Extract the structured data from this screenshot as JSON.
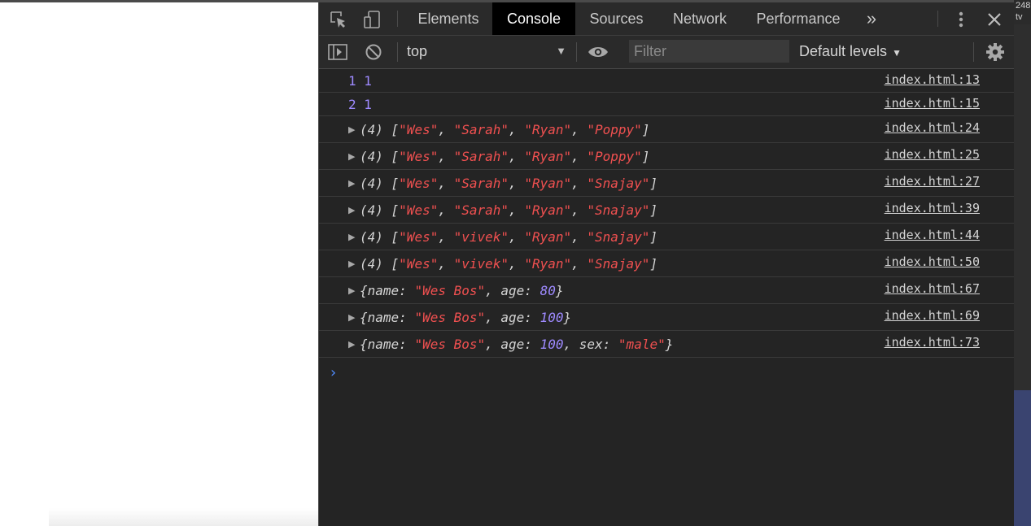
{
  "right_strip": {
    "text_top": "248",
    "text_second": "tv"
  },
  "devtools": {
    "tabs": [
      {
        "label": "Elements",
        "active": false
      },
      {
        "label": "Console",
        "active": true
      },
      {
        "label": "Sources",
        "active": false
      },
      {
        "label": "Network",
        "active": false
      },
      {
        "label": "Performance",
        "active": false
      }
    ],
    "more_tabs_glyph": "»",
    "toolbar": {
      "context": "top",
      "filter_placeholder": "Filter",
      "levels": "Default levels"
    },
    "colors": {
      "number": "#9e8aff",
      "string": "#f05050",
      "prompt": "#4f8cff",
      "active_tab_bg": "#000000"
    }
  },
  "console": {
    "rows": [
      {
        "tokens": [
          {
            "t": "1 1",
            "c": "num"
          }
        ],
        "source": "index.html:13",
        "expandable": false
      },
      {
        "tokens": [
          {
            "t": "2 1",
            "c": "num"
          }
        ],
        "source": "index.html:15",
        "expandable": false
      },
      {
        "tokens": [
          {
            "t": "(4) [",
            "c": "plain"
          },
          {
            "t": "\"Wes\"",
            "c": "str"
          },
          {
            "t": ", ",
            "c": "plain"
          },
          {
            "t": "\"Sarah\"",
            "c": "str"
          },
          {
            "t": ", ",
            "c": "plain"
          },
          {
            "t": "\"Ryan\"",
            "c": "str"
          },
          {
            "t": ", ",
            "c": "plain"
          },
          {
            "t": "\"Poppy\"",
            "c": "str"
          },
          {
            "t": "]",
            "c": "plain"
          }
        ],
        "source": "index.html:24",
        "expandable": true
      },
      {
        "tokens": [
          {
            "t": "(4) [",
            "c": "plain"
          },
          {
            "t": "\"Wes\"",
            "c": "str"
          },
          {
            "t": ", ",
            "c": "plain"
          },
          {
            "t": "\"Sarah\"",
            "c": "str"
          },
          {
            "t": ", ",
            "c": "plain"
          },
          {
            "t": "\"Ryan\"",
            "c": "str"
          },
          {
            "t": ", ",
            "c": "plain"
          },
          {
            "t": "\"Poppy\"",
            "c": "str"
          },
          {
            "t": "]",
            "c": "plain"
          }
        ],
        "source": "index.html:25",
        "expandable": true
      },
      {
        "tokens": [
          {
            "t": "(4) [",
            "c": "plain"
          },
          {
            "t": "\"Wes\"",
            "c": "str"
          },
          {
            "t": ", ",
            "c": "plain"
          },
          {
            "t": "\"Sarah\"",
            "c": "str"
          },
          {
            "t": ", ",
            "c": "plain"
          },
          {
            "t": "\"Ryan\"",
            "c": "str"
          },
          {
            "t": ", ",
            "c": "plain"
          },
          {
            "t": "\"Snajay\"",
            "c": "str"
          },
          {
            "t": "]",
            "c": "plain"
          }
        ],
        "source": "index.html:27",
        "expandable": true
      },
      {
        "tokens": [
          {
            "t": "(4) [",
            "c": "plain"
          },
          {
            "t": "\"Wes\"",
            "c": "str"
          },
          {
            "t": ", ",
            "c": "plain"
          },
          {
            "t": "\"Sarah\"",
            "c": "str"
          },
          {
            "t": ", ",
            "c": "plain"
          },
          {
            "t": "\"Ryan\"",
            "c": "str"
          },
          {
            "t": ", ",
            "c": "plain"
          },
          {
            "t": "\"Snajay\"",
            "c": "str"
          },
          {
            "t": "]",
            "c": "plain"
          }
        ],
        "source": "index.html:39",
        "expandable": true
      },
      {
        "tokens": [
          {
            "t": "(4) [",
            "c": "plain"
          },
          {
            "t": "\"Wes\"",
            "c": "str"
          },
          {
            "t": ", ",
            "c": "plain"
          },
          {
            "t": "\"vivek\"",
            "c": "str"
          },
          {
            "t": ", ",
            "c": "plain"
          },
          {
            "t": "\"Ryan\"",
            "c": "str"
          },
          {
            "t": ", ",
            "c": "plain"
          },
          {
            "t": "\"Snajay\"",
            "c": "str"
          },
          {
            "t": "]",
            "c": "plain"
          }
        ],
        "source": "index.html:44",
        "expandable": true
      },
      {
        "tokens": [
          {
            "t": "(4) [",
            "c": "plain"
          },
          {
            "t": "\"Wes\"",
            "c": "str"
          },
          {
            "t": ", ",
            "c": "plain"
          },
          {
            "t": "\"vivek\"",
            "c": "str"
          },
          {
            "t": ", ",
            "c": "plain"
          },
          {
            "t": "\"Ryan\"",
            "c": "str"
          },
          {
            "t": ", ",
            "c": "plain"
          },
          {
            "t": "\"Snajay\"",
            "c": "str"
          },
          {
            "t": "]",
            "c": "plain"
          }
        ],
        "source": "index.html:50",
        "expandable": true
      },
      {
        "tokens": [
          {
            "t": "{name: ",
            "c": "plain"
          },
          {
            "t": "\"Wes Bos\"",
            "c": "str"
          },
          {
            "t": ", age: ",
            "c": "plain"
          },
          {
            "t": "80",
            "c": "num"
          },
          {
            "t": "}",
            "c": "plain"
          }
        ],
        "source": "index.html:67",
        "expandable": true
      },
      {
        "tokens": [
          {
            "t": "{name: ",
            "c": "plain"
          },
          {
            "t": "\"Wes Bos\"",
            "c": "str"
          },
          {
            "t": ", age: ",
            "c": "plain"
          },
          {
            "t": "100",
            "c": "num"
          },
          {
            "t": "}",
            "c": "plain"
          }
        ],
        "source": "index.html:69",
        "expandable": true
      },
      {
        "tokens": [
          {
            "t": "{name: ",
            "c": "plain"
          },
          {
            "t": "\"Wes Bos\"",
            "c": "str"
          },
          {
            "t": ", age: ",
            "c": "plain"
          },
          {
            "t": "100",
            "c": "num"
          },
          {
            "t": ", sex: ",
            "c": "plain"
          },
          {
            "t": "\"male\"",
            "c": "str"
          },
          {
            "t": "}",
            "c": "plain"
          }
        ],
        "source": "index.html:73",
        "expandable": true
      }
    ],
    "prompt_glyph": "›"
  }
}
